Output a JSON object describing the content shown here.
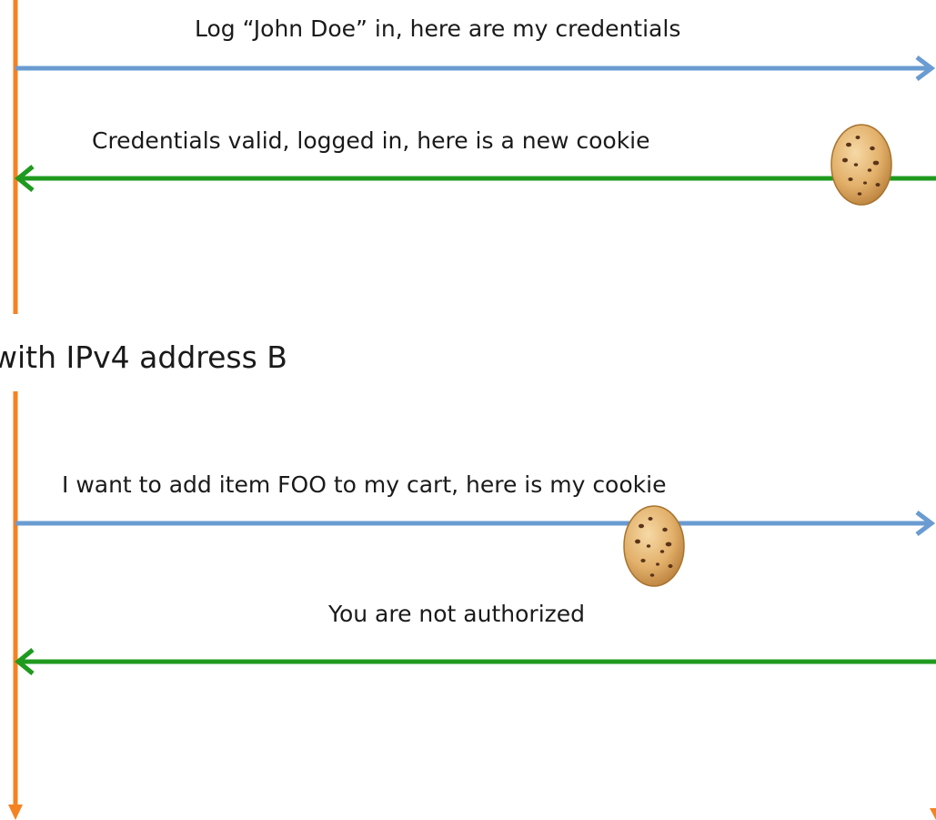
{
  "sections": [
    {
      "heading": "with IPv4 address B"
    }
  ],
  "messages": [
    {
      "label": "Log “John Doe” in, here are my credentials",
      "direction": "to-right",
      "cookie": false
    },
    {
      "label": "Credentials valid, logged in, here is a new cookie",
      "direction": "to-left",
      "cookie": true
    },
    {
      "label": "I want to add item FOO to my cart, here is my cookie",
      "direction": "to-right",
      "cookie": true
    },
    {
      "label": "You are not authorized",
      "direction": "to-left",
      "cookie": false
    }
  ],
  "colors": {
    "lifeline": "#f58220",
    "request_arrow": "#6a9bd1",
    "response_arrow": "#1f9a1f",
    "cookie_fill": "#e2b06a",
    "cookie_chip": "#5a3418"
  }
}
